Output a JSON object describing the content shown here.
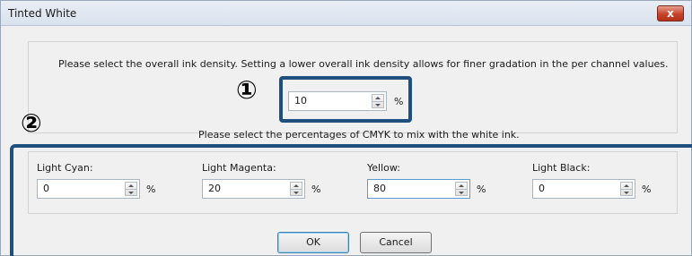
{
  "window": {
    "title": "Tinted White",
    "close_glyph": "x"
  },
  "density": {
    "instruction": "Please select the overall ink density. Setting a lower overall ink density allows for finer gradation in the per channel values.",
    "value": "10",
    "unit": "%",
    "marker": "①"
  },
  "mix": {
    "marker": "②",
    "instruction": "Please select the percentages of CMYK to mix with the white ink.",
    "channels": [
      {
        "label": "Light Cyan:",
        "value": "0",
        "unit": "%"
      },
      {
        "label": "Light Magenta:",
        "value": "20",
        "unit": "%"
      },
      {
        "label": "Yellow:",
        "value": "80",
        "unit": "%"
      },
      {
        "label": "Light Black:",
        "value": "0",
        "unit": "%"
      }
    ]
  },
  "buttons": {
    "ok": "OK",
    "cancel": "Cancel"
  },
  "colors": {
    "highlight": "#1e4f7f",
    "close_button": "#c7432a"
  }
}
